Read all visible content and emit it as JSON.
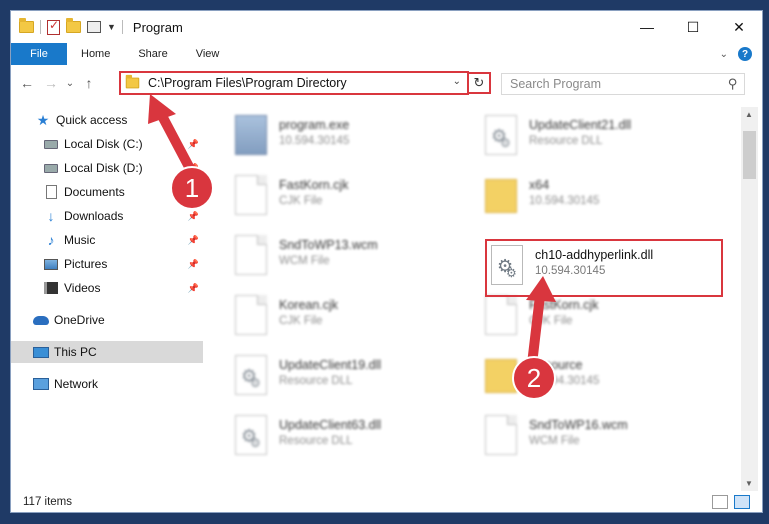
{
  "window": {
    "title": "Program",
    "controls": {
      "minimize": "—",
      "maximize": "☐",
      "close": "✕"
    }
  },
  "ribbon": {
    "tabs": [
      {
        "label": "File"
      },
      {
        "label": "Home"
      },
      {
        "label": "Share"
      },
      {
        "label": "View"
      }
    ],
    "help": "?"
  },
  "nav": {
    "back": "←",
    "forward": "→",
    "recent": "⌄",
    "up": "↑",
    "address": "C:\\Program Files\\Program Directory",
    "address_dropdown": "⌄",
    "refresh": "↻",
    "search_placeholder": "Search Program"
  },
  "sidebar": {
    "items": [
      {
        "label": "Quick access",
        "icon": "star-icon"
      },
      {
        "label": "Local Disk (C:)",
        "icon": "disk-icon",
        "pinned": true
      },
      {
        "label": "Local Disk (D:)",
        "icon": "disk-icon",
        "pinned": true
      },
      {
        "label": "Documents",
        "icon": "document-icon",
        "pinned": true
      },
      {
        "label": "Downloads",
        "icon": "download-icon",
        "pinned": true
      },
      {
        "label": "Music",
        "icon": "music-icon",
        "pinned": true
      },
      {
        "label": "Pictures",
        "icon": "pictures-icon",
        "pinned": true
      },
      {
        "label": "Videos",
        "icon": "videos-icon",
        "pinned": true
      },
      {
        "label": "OneDrive",
        "icon": "cloud-icon"
      },
      {
        "label": "This PC",
        "icon": "computer-icon",
        "selected": true
      },
      {
        "label": "Network",
        "icon": "network-icon"
      }
    ]
  },
  "files": {
    "left": [
      {
        "name": "program.exe",
        "sub": "10.594.30145",
        "type": "exe"
      },
      {
        "name": "FastKorn.cjk",
        "sub": "CJK File",
        "type": "page"
      },
      {
        "name": "SndToWP13.wcm",
        "sub": "WCM File",
        "type": "page"
      },
      {
        "name": "Korean.cjk",
        "sub": "CJK File",
        "type": "page"
      },
      {
        "name": "UpdateClient19.dll",
        "sub": "Resource DLL",
        "type": "dll"
      },
      {
        "name": "UpdateClient63.dll",
        "sub": "Resource DLL",
        "type": "dll"
      }
    ],
    "right": [
      {
        "name": "UpdateClient21.dll",
        "sub": "Resource DLL",
        "type": "dll"
      },
      {
        "name": "x64",
        "sub": "10.594.30145",
        "type": "folder"
      },
      {
        "name": "ch10-addhyperlink.dll",
        "sub": "10.594.30145",
        "type": "dll",
        "highlighted": true
      },
      {
        "name": "FastKorn.cjk",
        "sub": "CJK File",
        "type": "page"
      },
      {
        "name": "Resource",
        "sub": "10.594.30145",
        "type": "folder"
      },
      {
        "name": "SndToWP16.wcm",
        "sub": "WCM File",
        "type": "page"
      }
    ]
  },
  "status": {
    "count": "117 items"
  },
  "annotations": {
    "step1": "1",
    "step2": "2",
    "color": "#d9363e"
  },
  "scroll": {
    "up": "▲",
    "down": "▼"
  }
}
